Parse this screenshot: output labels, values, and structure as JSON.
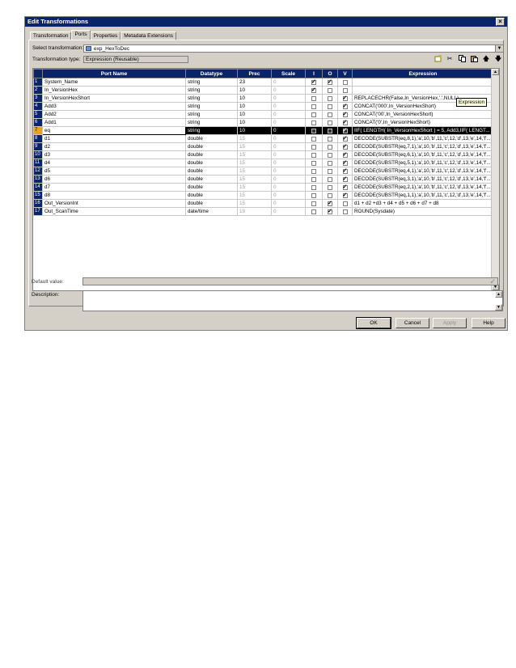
{
  "window": {
    "title": "Edit Transformations"
  },
  "tabs": [
    "Transformation",
    "Ports",
    "Properties",
    "Metadata Extensions"
  ],
  "active_tab": "Ports",
  "form": {
    "select_label": "Select transformation:",
    "select_value": "exp_HexToDec",
    "type_label": "Transformation type:",
    "type_value": "Expression (Reusable)",
    "default_label": "Default value:",
    "description_label": "Description:"
  },
  "tooltip": "Expression",
  "columns": [
    "Port Name",
    "Datatype",
    "Prec",
    "Scale",
    "I",
    "O",
    "V",
    "Expression"
  ],
  "rows": [
    {
      "n": "1",
      "name": "System_Name",
      "type": "string",
      "prec": "23",
      "scale": "0",
      "i": true,
      "o": true,
      "v": false,
      "expr": ""
    },
    {
      "n": "2",
      "name": "In_VersionHex",
      "type": "string",
      "prec": "10",
      "scale": "0",
      "i": true,
      "o": false,
      "v": false,
      "expr": ""
    },
    {
      "n": "3",
      "name": "In_VersionHexShort",
      "type": "string",
      "prec": "10",
      "scale": "0",
      "i": false,
      "o": false,
      "v": true,
      "expr": "REPLACECHR(False,In_VersionHex,'.',NULL)"
    },
    {
      "n": "4",
      "name": "Add3",
      "type": "string",
      "prec": "10",
      "scale": "0",
      "i": false,
      "o": false,
      "v": true,
      "expr": "CONCAT('000',In_VersionHexShort)"
    },
    {
      "n": "5",
      "name": "Add2",
      "type": "string",
      "prec": "10",
      "scale": "0",
      "i": false,
      "o": false,
      "v": true,
      "expr": "CONCAT('00',In_VersionHexShort)"
    },
    {
      "n": "6",
      "name": "Add1",
      "type": "string",
      "prec": "10",
      "scale": "0",
      "i": false,
      "o": false,
      "v": true,
      "expr": "CONCAT('0',In_VersionHexShort)"
    },
    {
      "n": "7",
      "name": "eq",
      "type": "string",
      "prec": "10",
      "scale": "0",
      "i": false,
      "o": false,
      "v": true,
      "expr": "IIF( LENGTH( In_VersionHexShort ) = 5, Add3,IIF( LENGT...",
      "selected": true
    },
    {
      "n": "8",
      "name": "d1",
      "type": "double",
      "prec": "15",
      "scale": "0",
      "i": false,
      "o": false,
      "v": true,
      "expr": "DECODE(SUBSTR(eq,8,1),'a',10,'b',11,'c',12,'d',13,'e',14,'f'..."
    },
    {
      "n": "9",
      "name": "d2",
      "type": "double",
      "prec": "15",
      "scale": "0",
      "i": false,
      "o": false,
      "v": true,
      "expr": "DECODE(SUBSTR(eq,7,1),'a',10,'b',11,'c',12,'d',13,'e',14,'f'..."
    },
    {
      "n": "10",
      "name": "d3",
      "type": "double",
      "prec": "15",
      "scale": "0",
      "i": false,
      "o": false,
      "v": true,
      "expr": "DECODE(SUBSTR(eq,6,1),'a',10,'b',11,'c',12,'d',13,'e',14,'f'..."
    },
    {
      "n": "11",
      "name": "d4",
      "type": "double",
      "prec": "15",
      "scale": "0",
      "i": false,
      "o": false,
      "v": true,
      "expr": "DECODE(SUBSTR(eq,5,1),'a',10,'b',11,'c',12,'d',13,'e',14,'f'..."
    },
    {
      "n": "12",
      "name": "d5",
      "type": "double",
      "prec": "15",
      "scale": "0",
      "i": false,
      "o": false,
      "v": true,
      "expr": "DECODE(SUBSTR(eq,4,1),'a',10,'b',11,'c',12,'d',13,'e',14,'f'..."
    },
    {
      "n": "13",
      "name": "d6",
      "type": "double",
      "prec": "15",
      "scale": "0",
      "i": false,
      "o": false,
      "v": true,
      "expr": "DECODE(SUBSTR(eq,3,1),'a',10,'b',11,'c',12,'d',13,'e',14,'f'..."
    },
    {
      "n": "14",
      "name": "d7",
      "type": "double",
      "prec": "15",
      "scale": "0",
      "i": false,
      "o": false,
      "v": true,
      "expr": "DECODE(SUBSTR(eq,2,1),'a',10,'b',11,'c',12,'d',13,'e',14,'f'..."
    },
    {
      "n": "15",
      "name": "d8",
      "type": "double",
      "prec": "15",
      "scale": "0",
      "i": false,
      "o": false,
      "v": true,
      "expr": "DECODE(SUBSTR(eq,1,1),'a',10,'b',11,'c',12,'d',13,'e',14,'f'..."
    },
    {
      "n": "16",
      "name": "Out_VersionInt",
      "type": "double",
      "prec": "15",
      "scale": "0",
      "i": false,
      "o": true,
      "v": false,
      "expr": "d1 + d2 +d3 + d4 + d5 + d6 + d7 + d8"
    },
    {
      "n": "17",
      "name": "Out_ScanTime",
      "type": "date/time",
      "prec": "19",
      "scale": "0",
      "i": false,
      "o": true,
      "v": false,
      "expr": "ROUND(Sysdate)"
    }
  ],
  "buttons": {
    "ok": "OK",
    "cancel": "Cancel",
    "apply": "Apply",
    "help": "Help"
  },
  "icons": [
    "new-port-icon",
    "cut-icon",
    "copy-icon",
    "paste-icon",
    "move-up-icon",
    "move-down-icon"
  ]
}
